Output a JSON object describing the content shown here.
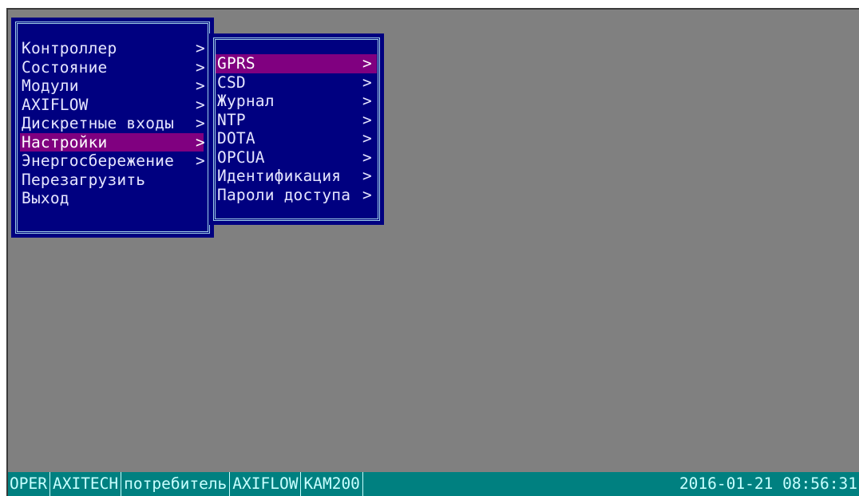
{
  "main_menu": {
    "items": [
      {
        "label": "Контроллер",
        "arrow": ">"
      },
      {
        "label": "Состояние",
        "arrow": ">"
      },
      {
        "label": "Модули",
        "arrow": ">"
      },
      {
        "label": "AXIFLOW",
        "arrow": ">"
      },
      {
        "label": "Дискретные входы",
        "arrow": ">"
      },
      {
        "label": "Настройки",
        "arrow": ">",
        "selected": true
      },
      {
        "label": "Энергосбережение",
        "arrow": ">"
      },
      {
        "label": "Перезагрузить",
        "arrow": ""
      },
      {
        "label": "Выход",
        "arrow": ""
      }
    ]
  },
  "sub_menu": {
    "items": [
      {
        "label": "GPRS",
        "arrow": ">",
        "selected": true
      },
      {
        "label": "CSD",
        "arrow": ">"
      },
      {
        "label": "Журнал",
        "arrow": ">"
      },
      {
        "label": "NTP",
        "arrow": ">"
      },
      {
        "label": "DOTA",
        "arrow": ">"
      },
      {
        "label": "OPCUA",
        "arrow": ">"
      },
      {
        "label": "Идентификация",
        "arrow": ">"
      },
      {
        "label": "Пароли доступа",
        "arrow": ">"
      }
    ]
  },
  "status_bar": {
    "segments": [
      "OPER",
      "AXITECH",
      "потребитель",
      "AXIFLOW",
      "KAM200"
    ],
    "datetime": "2016-01-21 08:56:31"
  },
  "colors": {
    "desktop": "#808080",
    "menu_bg": "#000080",
    "menu_border": "#9fd0e8",
    "selection": "#800080",
    "status_bar": "#008080"
  }
}
